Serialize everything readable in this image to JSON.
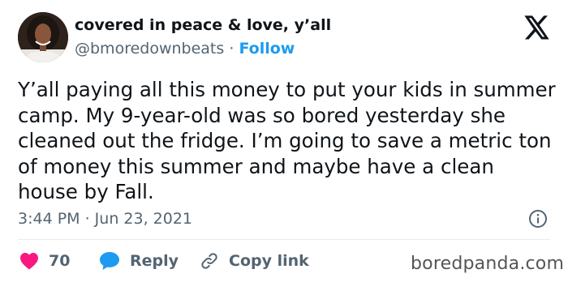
{
  "author": {
    "display_name": "covered in peace & love, y’all",
    "handle": "@bmoredownbeats",
    "separator": "·",
    "follow_label": "Follow"
  },
  "tweet": {
    "text": "Y’all paying all this money to put your kids in summer camp. My 9-year-old was so bored yesterday she cleaned out the fridge. I’m going to save a metric ton of money this summer and maybe have a clean house by Fall.",
    "timestamp": "3:44 PM · Jun 23, 2021"
  },
  "actions": {
    "like_count": "70",
    "reply_label": "Reply",
    "copy_link_label": "Copy link"
  },
  "watermark": "boredpanda.com",
  "colors": {
    "link_blue": "#1d9bf0",
    "like_red": "#f91880",
    "text_primary": "#0f1419",
    "text_secondary": "#536471",
    "divider": "#e6ecf0"
  },
  "icons": {
    "platform": "x-logo-icon",
    "info": "info-icon",
    "like": "heart-icon",
    "reply": "speech-bubble-icon",
    "copy_link": "link-icon"
  }
}
